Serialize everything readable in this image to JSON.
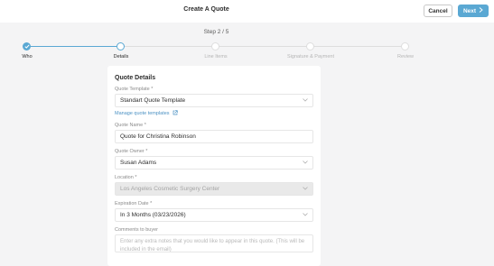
{
  "header": {
    "title": "Create A Quote",
    "cancel_label": "Cancel",
    "next_label": "Next"
  },
  "progress": {
    "step_text": "Step 2 / 5",
    "steps": [
      "Who",
      "Details",
      "Line Items",
      "Signature & Payment",
      "Review"
    ]
  },
  "form": {
    "title": "Quote Details",
    "template_label": "Quote Template *",
    "template_value": "Standart Quote Template",
    "manage_link": "Manage quote templates",
    "name_label": "Quote Name *",
    "name_value": "Quote for Christina Robinson",
    "owner_label": "Quote Owner *",
    "owner_value": "Susan Adams",
    "location_label": "Location *",
    "location_value": "Los Angeles Cosmetic Surgery Center",
    "expiration_label": "Expiration Date *",
    "expiration_value": "In 3 Months (03/23/2026)",
    "comments_label": "Comments to buyer",
    "comments_placeholder": "Enter any extra notes that you would like to appear in this quote. (This will be included in the email)"
  },
  "colors": {
    "accent": "#5aa8d3",
    "link": "#4b91c3"
  }
}
